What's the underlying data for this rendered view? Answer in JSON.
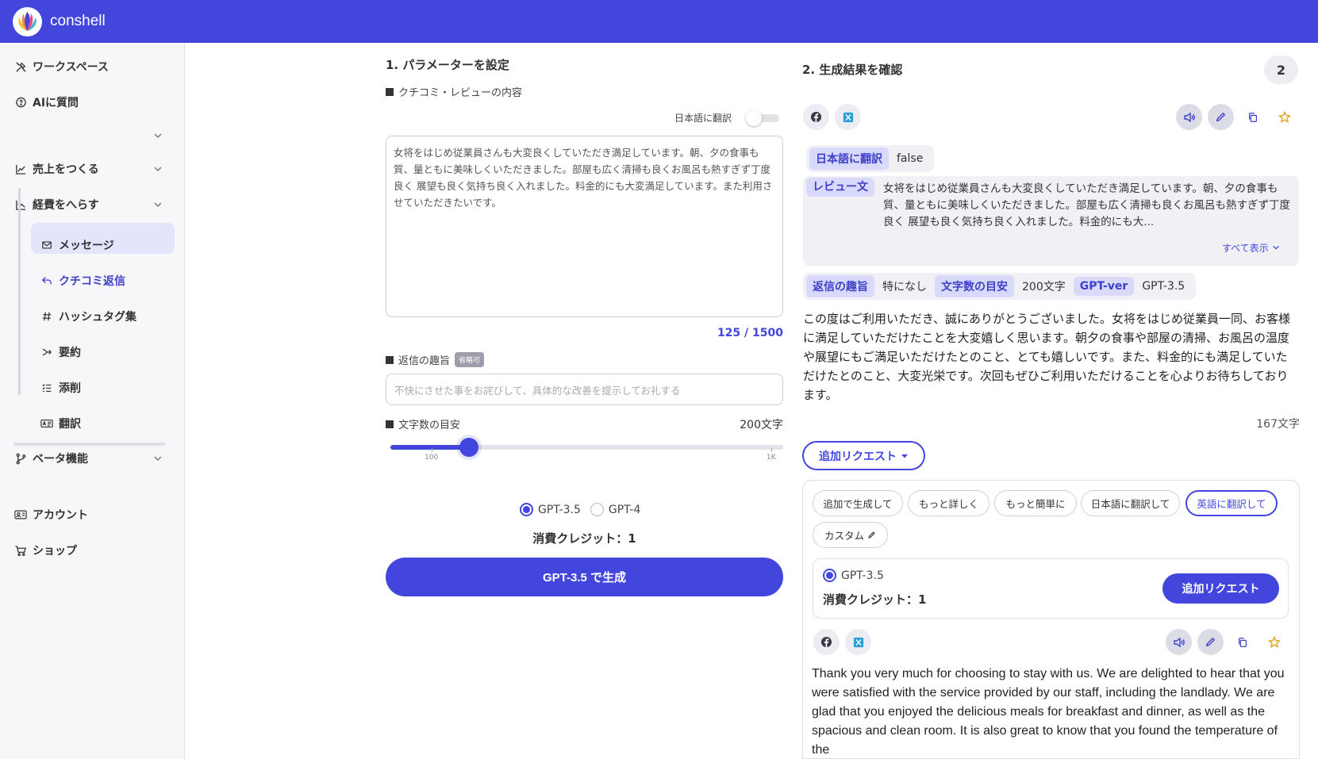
{
  "app": {
    "brand": "conshell"
  },
  "sidebar": {
    "workspace": "ワークスペース",
    "ask_ai": "AIに質問",
    "sales": "売上をつくる",
    "cost": "経費をへらす",
    "sub_items": [
      {
        "label": "メッセージ",
        "icon": "mail-icon"
      },
      {
        "label": "クチコミ返信",
        "icon": "reply-icon"
      },
      {
        "label": "ハッシュタグ集",
        "icon": "hash-icon"
      },
      {
        "label": "要約",
        "icon": "summary-icon"
      },
      {
        "label": "添削",
        "icon": "checklist-icon"
      },
      {
        "label": "翻訳",
        "icon": "translate-icon"
      }
    ],
    "beta": "ベータ機能",
    "account": "アカウント",
    "shop": "ショップ"
  },
  "params": {
    "title": "1. パラメーターを設定",
    "review_label": "クチコミ・レビューの内容",
    "translate_toggle_label": "日本語に翻訳",
    "translate_on": false,
    "review_text": "女将をはじめ従業員さんも大変良くしていただき満足しています。朝、夕の食事も質、量ともに美味しくいただきました。部屋も広く清掃も良くお風呂も熱すぎず丁度良く 展望も良く気持ち良く入れました。料金的にも大変満足しています。また利用させていただきたいです。",
    "counter": "125 / 1500",
    "purpose_label": "返信の趣旨",
    "optional_badge": "省略可",
    "purpose_placeholder": "不快にさせた事をお詫びして、具体的な改善を提示してお礼する",
    "length_label": "文字数の目安",
    "length_value": "200文字",
    "slider_fraction": 0.2,
    "tick_min": "100",
    "tick_max": "1K",
    "model_options": [
      "GPT-3.5",
      "GPT-4"
    ],
    "selected_model": "GPT-3.5",
    "credit": "消費クレジット：1",
    "generate_label": "GPT-3.5 で生成"
  },
  "results": {
    "title": "2. 生成結果を確認",
    "count": "2",
    "meta": {
      "translate_tag": "日本語に翻訳",
      "translate_val": "false",
      "review_tag": "レビュー文",
      "review_preview": "女将をはじめ従業員さんも大変良くしていただき満足しています。朝、夕の食事も質、量ともに美味しくいただきました。部屋も広く清掃も良くお風呂も熱すぎず丁度良く 展望も良く気持ち良く入れました。料金的にも大...",
      "show_all": "すべて表示",
      "purpose_tag": "返信の趣旨",
      "purpose_val": "特になし",
      "length_tag": "文字数の目安",
      "length_val": "200文字",
      "gpt_tag": "GPT-ver",
      "gpt_val": "GPT-3.5"
    },
    "reply_text": "この度はご利用いただき、誠にありがとうございました。女将をはじめ従業員一同、お客様に満足していただけたことを大変嬉しく思います。朝夕の食事や部屋の清掃、お風呂の温度や展望にもご満足いただけたとのこと、とても嬉しいです。また、料金的にも満足していただけたとのこと、大変光栄です。次回もぜひご利用いただけることを心よりお待ちしております。",
    "char_count": "167文字",
    "request_dropdown": "追加リクエスト",
    "chips": [
      "追加で生成して",
      "もっと詳しく",
      "もっと簡単に",
      "日本語に翻訳して",
      "英語に翻訳して",
      "カスタム"
    ],
    "selected_chip": "英語に翻訳して",
    "inner_model": "GPT-3.5",
    "inner_credit": "消費クレジット：1",
    "inner_button": "追加リクエスト",
    "english_text": "Thank you very much for choosing to stay with us. We are delighted to hear that you were satisfied with the service provided by our staff, including the landlady. We are glad that you enjoyed the delicious meals for breakfast and dinner, as well as the spacious and clean room. It is also great to know that you found the temperature of the"
  },
  "colors": {
    "brand": "#4346dd",
    "tag_bg": "#d9d9fb",
    "star": "#e3a21a"
  }
}
